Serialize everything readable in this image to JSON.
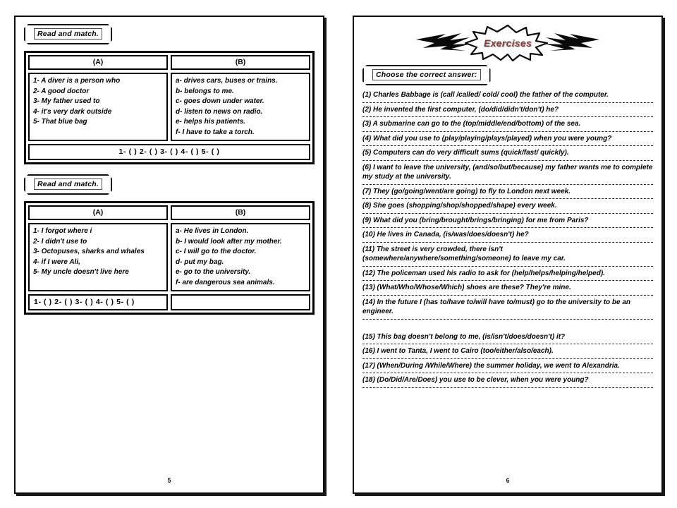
{
  "document": {
    "title": "English Worksheet - Read and match / Exercises"
  },
  "left_page": {
    "page_number": "5",
    "sections": [
      {
        "banner_label": "Read and match.",
        "column_a_header": "(A)",
        "column_b_header": "(B)",
        "column_a_items": [
          "1- A diver is a person who",
          "2- A good doctor",
          "3- My father used to",
          "4- it's very dark outside",
          "5- That blue bag"
        ],
        "column_b_items": [
          "a- drives cars, buses or trains.",
          "b- belongs to me.",
          "c- goes down under water.",
          "d- listen to news on radio.",
          "e- helps his patients.",
          "f- I have to take a torch."
        ],
        "answer_row": "1- (   ) 2- (   ) 3- (   ) 4- (   ) 5- (   )",
        "answer_row_split": false
      },
      {
        "banner_label": "Read and match.",
        "column_a_header": "(A)",
        "column_b_header": "(B)",
        "column_a_items": [
          "1- I forgot where i",
          "2- I didn't use to",
          "3- Octopuses, sharks and whales",
          "4- if I were Ali,",
          "5- My uncle doesn't live here"
        ],
        "column_b_items": [
          "a- He lives in London.",
          "b- I would look after my mother.",
          "c- I will go to the doctor.",
          "d- put my bag.",
          "e- go to the university.",
          "f- are dangerous sea animals."
        ],
        "answer_row": "1- (   ) 2- (   ) 3- (   ) 4- (   ) 5- (   )",
        "answer_row_split": true
      }
    ]
  },
  "right_page": {
    "page_number": "6",
    "exercises_title": "Exercises",
    "exercises_title_color": "#8c3b34",
    "instruction_banner": "Choose the correct answer:",
    "questions": [
      {
        "text": "(1) Charles Babbage is (call /called/ cold/ cool) the father of the computer."
      },
      {
        "text": "(2) He invented the first computer, (do/did/didn't/don't) he?"
      },
      {
        "text": "(3) A submarine can go to the (top/middle/end/bottom) of the sea."
      },
      {
        "text": "(4) What did you use to (play/playing/plays/played) when you were young?"
      },
      {
        "text": "(5) Computers can do very difficult sums (quick/fast/ quickly)."
      },
      {
        "text": "(6) I want to leave the university, (and/so/but/because) my father wants me to complete my study at the university."
      },
      {
        "text": "(7) They (go/going/went/are going) to fly to London next week."
      },
      {
        "text": "(8) She goes (shopping/shop/shopped/shape) every week."
      },
      {
        "text": "(9) What did you (bring/brought/brings/bringing) for me from Paris?"
      },
      {
        "text": "(10) He lives in Canada, (is/was/does/doesn't) he?"
      },
      {
        "text": "(11) The street is very crowded, there isn't (somewhere/anywhere/something/someone) to leave my car."
      },
      {
        "text": "(12) The policeman used his radio to ask for (help/helps/helping/helped)."
      },
      {
        "text": "(13) (What/Who/Whose/Which) shoes are these? They're mine."
      },
      {
        "text": "(14) In the future I (has to/have to/will have to/must) go to the university to be an engineer.",
        "gap_after": true
      },
      {
        "text": "(15) This bag doesn't belong to me, (is/isn't/does/doesn't) it?"
      },
      {
        "text": "(16) I went to Tanta, I went to Cairo (too/either/also/each)."
      },
      {
        "text": "(17) (When/During /While/Where) the summer holiday, we went to Alexandria."
      },
      {
        "text": "(18) (Do/Did/Are/Does) you use to be clever, when you were young?"
      }
    ]
  }
}
